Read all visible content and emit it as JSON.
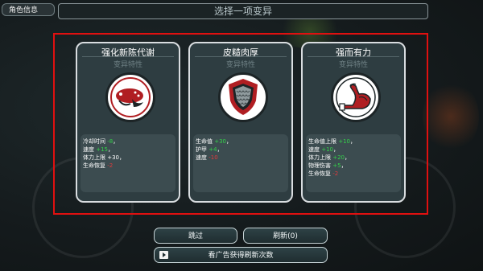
{
  "header": {
    "char_info_label": "角色信息",
    "title": "选择一项变异"
  },
  "cards": [
    {
      "title": "强化新陈代谢",
      "subtitle": "变异特性",
      "emblem_icon": "fish-emblem-icon",
      "stats": [
        {
          "label": "冷却时间 ",
          "value": "-8",
          "sign": "pos",
          "suffix": "，"
        },
        {
          "label": "速度 ",
          "value": "+15",
          "sign": "pos",
          "suffix": "，"
        },
        {
          "label": "体力上限 ",
          "value": "+30",
          "sign": "neutral",
          "suffix": "，"
        },
        {
          "label": "生命恢复 ",
          "value": "-2",
          "sign": "neg",
          "suffix": ""
        }
      ]
    },
    {
      "title": "皮糙肉厚",
      "subtitle": "变异特性",
      "emblem_icon": "scale-shield-icon",
      "stats": [
        {
          "label": "生命值 ",
          "value": "+30",
          "sign": "pos",
          "suffix": "，"
        },
        {
          "label": "护甲 ",
          "value": "+4",
          "sign": "pos",
          "suffix": "，"
        },
        {
          "label": "速度 ",
          "value": "-10",
          "sign": "neg",
          "suffix": ""
        }
      ]
    },
    {
      "title": "强而有力",
      "subtitle": "变异特性",
      "emblem_icon": "flexed-arm-icon",
      "stats": [
        {
          "label": "生命值上限 ",
          "value": "+10",
          "sign": "pos",
          "suffix": "，"
        },
        {
          "label": "速度 ",
          "value": "+10",
          "sign": "pos",
          "suffix": "，"
        },
        {
          "label": "体力上限 ",
          "value": "+20",
          "sign": "pos",
          "suffix": "，"
        },
        {
          "label": "物理伤害 ",
          "value": "+5",
          "sign": "pos",
          "suffix": "，"
        },
        {
          "label": "生命恢复 ",
          "value": "-2",
          "sign": "neg",
          "suffix": ""
        }
      ]
    }
  ],
  "buttons": {
    "skip": "跳过",
    "refresh": "刷新(0)",
    "watch_ad": "看广告获得刷新次数"
  },
  "colors": {
    "highlight": "#e01010",
    "positive": "#34d24a",
    "negative": "#e23b3b",
    "emblem_red": "#b01e22"
  }
}
